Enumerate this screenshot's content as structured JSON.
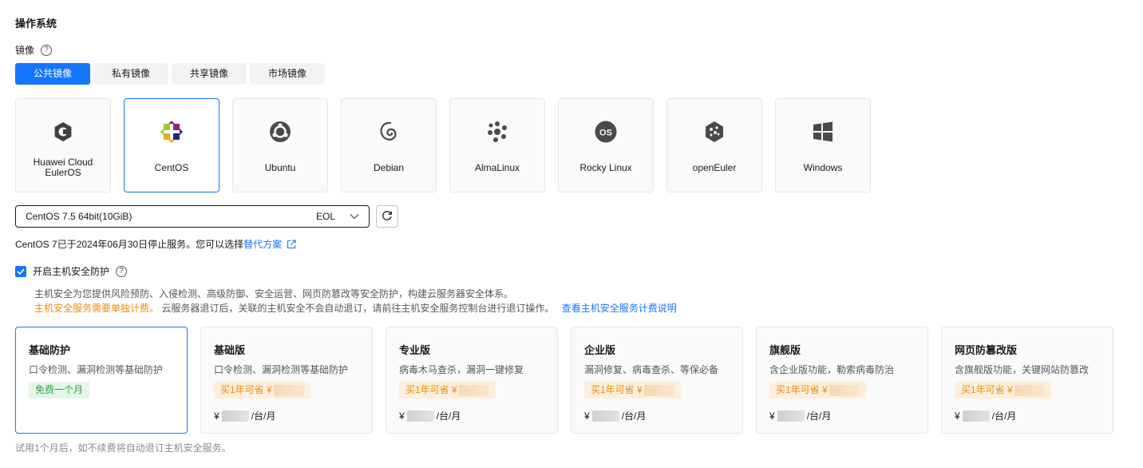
{
  "section": {
    "title": "操作系统"
  },
  "image": {
    "label": "镜像",
    "help": "?",
    "tabs": [
      {
        "label": "公共镜像",
        "active": true
      },
      {
        "label": "私有镜像",
        "active": false
      },
      {
        "label": "共享镜像",
        "active": false
      },
      {
        "label": "市场镜像",
        "active": false
      }
    ]
  },
  "os_list": [
    {
      "name": "Huawei Cloud EulerOS",
      "icon": "huawei-cloud-euleros-icon"
    },
    {
      "name": "CentOS",
      "icon": "centos-icon",
      "selected": true
    },
    {
      "name": "Ubuntu",
      "icon": "ubuntu-icon"
    },
    {
      "name": "Debian",
      "icon": "debian-icon"
    },
    {
      "name": "AlmaLinux",
      "icon": "almalinux-icon"
    },
    {
      "name": "Rocky Linux",
      "icon": "rocky-linux-icon"
    },
    {
      "name": "openEuler",
      "icon": "openeuler-icon"
    },
    {
      "name": "Windows",
      "icon": "windows-icon"
    }
  ],
  "version": {
    "value": "CentOS 7.5 64bit(10GiB)",
    "tag": "EOL"
  },
  "eol_note": {
    "text": "CentOS 7已于2024年06月30日停止服务。您可以选择",
    "link": "替代方案"
  },
  "hss": {
    "checkbox_label": "开启主机安全防护",
    "help": "?",
    "desc_line1": "主机安全为您提供风险预防、入侵检测、高级防御、安全运营、网页防篡改等安全防护，构建云服务器安全体系。",
    "warn": "主机安全服务需要单独计费。",
    "desc_line2": "云服务器退订后，关联的主机安全不会自动退订，请前往主机安全服务控制台进行退订操作。",
    "link": "查看主机安全服务计费说明"
  },
  "plans": [
    {
      "name": "基础防护",
      "desc": "口令检测、漏洞检测等基础防护",
      "badge": "免费一个月",
      "badge_type": "green",
      "selected": true
    },
    {
      "name": "基础版",
      "desc": "口令检测、漏洞检测等基础防护",
      "badge": "买1年可省 ¥",
      "badge_type": "orange",
      "price_prefix": "¥",
      "price_unit": "/台/月"
    },
    {
      "name": "专业版",
      "desc": "病毒木马查杀，漏洞一键修复",
      "badge": "买1年可省 ¥",
      "badge_type": "orange",
      "price_prefix": "¥",
      "price_unit": "/台/月"
    },
    {
      "name": "企业版",
      "desc": "漏洞修复、病毒查杀、等保必备",
      "badge": "买1年可省 ¥",
      "badge_type": "orange",
      "price_prefix": "¥",
      "price_unit": "/台/月"
    },
    {
      "name": "旗舰版",
      "desc": "含企业版功能，勒索病毒防治",
      "badge": "买1年可省 ¥",
      "badge_type": "orange",
      "price_prefix": "¥",
      "price_unit": "/台/月"
    },
    {
      "name": "网页防篡改版",
      "desc": "含旗舰版功能，关键网站防篡改",
      "badge": "买1年可省 ¥",
      "badge_type": "orange",
      "price_prefix": "¥",
      "price_unit": "/台/月"
    }
  ],
  "trial_note": "试用1个月后，如不续费将自动退订主机安全服务。",
  "colors": {
    "accent": "#1476ff",
    "warn": "#ee8b0d",
    "success": "#2aa845"
  }
}
